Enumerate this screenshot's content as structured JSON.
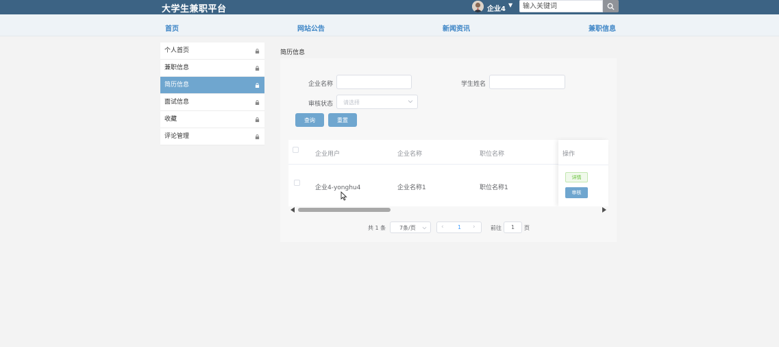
{
  "header": {
    "site_title": "大学生兼职平台",
    "user_name": "企业4",
    "search_placeholder": "输入关键词"
  },
  "nav": {
    "items": [
      "首页",
      "网站公告",
      "新闻资讯",
      "兼职信息"
    ]
  },
  "sidebar": {
    "items": [
      {
        "label": "个人首页",
        "active": false
      },
      {
        "label": "兼职信息",
        "active": false
      },
      {
        "label": "简历信息",
        "active": true
      },
      {
        "label": "面试信息",
        "active": false
      },
      {
        "label": "收藏",
        "active": false
      },
      {
        "label": "评论管理",
        "active": false
      }
    ]
  },
  "breadcrumb": "简历信息",
  "filters": {
    "company_name_label": "企业名称",
    "student_name_label": "学生姓名",
    "status_label": "审核状态",
    "status_placeholder": "请选择",
    "search_button": "查询",
    "reset_button": "重置"
  },
  "table": {
    "columns": [
      "企业用户",
      "企业名称",
      "职位名称",
      "操作"
    ],
    "rows": [
      {
        "company_user": "企业4-yonghu4",
        "company_name": "企业名称1",
        "position": "职位名称1",
        "detail_label": "详情",
        "audit_label": "审核"
      }
    ]
  },
  "pagination": {
    "total_text": "共 1 条",
    "page_size": "7条/页",
    "current_page": "1",
    "goto_label": "前往",
    "goto_value": "1",
    "page_unit": "页"
  },
  "colors": {
    "topbar": "#3c6384",
    "accent": "#6fa6cf",
    "nav_text": "#3d85c6"
  }
}
